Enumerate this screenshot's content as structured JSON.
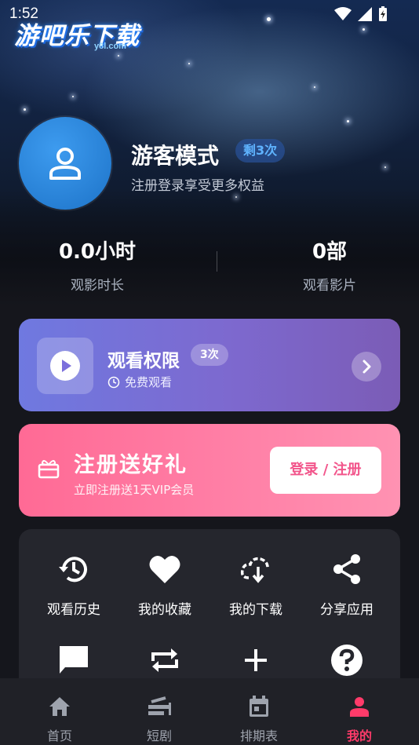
{
  "status_bar": {
    "time": "1:52"
  },
  "brand": {
    "logo_text": "游吧乐下载",
    "logo_sub": "y8l.com"
  },
  "user": {
    "name": "游客模式",
    "remain_badge": "剩3次",
    "subtitle": "注册登录享受更多权益"
  },
  "stats": [
    {
      "value": "0.0小时",
      "label": "观影时长"
    },
    {
      "value": "0部",
      "label": "观看影片"
    }
  ],
  "permission_card": {
    "title": "观看权限",
    "badge": "3次",
    "subtitle": "免费观看"
  },
  "register_card": {
    "title": "注册送好礼",
    "subtitle": "立即注册送1天VIP会员",
    "button_label": "登录 / 注册"
  },
  "features": [
    {
      "label": "观看历史",
      "icon": "history-icon"
    },
    {
      "label": "我的收藏",
      "icon": "heart-icon"
    },
    {
      "label": "我的下载",
      "icon": "download-icon"
    },
    {
      "label": "分享应用",
      "icon": "share-icon"
    },
    {
      "label": "",
      "icon": "feedback-icon"
    },
    {
      "label": "",
      "icon": "repeat-icon"
    },
    {
      "label": "",
      "icon": "plus-icon"
    },
    {
      "label": "",
      "icon": "help-icon"
    }
  ],
  "nav": [
    {
      "label": "首页",
      "icon": "home-icon"
    },
    {
      "label": "短剧",
      "icon": "drama-icon"
    },
    {
      "label": "排期表",
      "icon": "calendar-icon"
    },
    {
      "label": "我的",
      "icon": "profile-icon",
      "active": true
    }
  ],
  "colors": {
    "accent": "#ff3b6a",
    "avatar_blue": "#2a86dc",
    "permission_gradient": [
      "#6f79e0",
      "#7b5cb6"
    ],
    "register_gradient": [
      "#ff6a95",
      "#ff92b2"
    ]
  }
}
